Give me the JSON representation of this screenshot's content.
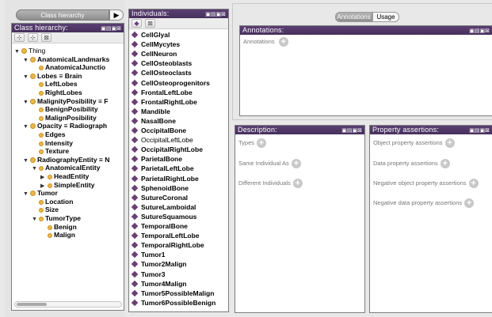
{
  "class_panel": {
    "tab_label": "Class hierarchy",
    "tab_arrow": "▶",
    "view_title": "Class hierarchy:",
    "view_controls": "▣▤▣⊠",
    "toolbar_icons": [
      "add-subclass-icon",
      "add-sibling-icon",
      "delete-class-icon"
    ],
    "tree": [
      {
        "label": "Thing",
        "arrow": "▼",
        "depth": 0
      },
      {
        "label": "AnatomicalLandmarks",
        "arrow": "▼",
        "depth": 1
      },
      {
        "label": "AnatomicalJunctio",
        "arrow": "",
        "depth": 2
      },
      {
        "label": "Lobes ≡ Brain",
        "arrow": "▼",
        "depth": 1
      },
      {
        "label": "LeftLobes",
        "arrow": "",
        "depth": 2
      },
      {
        "label": "RightLobes",
        "arrow": "",
        "depth": 2
      },
      {
        "label": "MalignityPosibility ≡ F",
        "arrow": "▼",
        "depth": 1
      },
      {
        "label": "BenignPosibility",
        "arrow": "",
        "depth": 2
      },
      {
        "label": "MalignPosibility",
        "arrow": "",
        "depth": 2
      },
      {
        "label": "Opacity ≡ Radiograph",
        "arrow": "▼",
        "depth": 1
      },
      {
        "label": "Edges",
        "arrow": "",
        "depth": 2
      },
      {
        "label": "Intensity",
        "arrow": "",
        "depth": 2
      },
      {
        "label": "Texture",
        "arrow": "",
        "depth": 2
      },
      {
        "label": "RadiographyEntity ≡ N",
        "arrow": "▼",
        "depth": 1
      },
      {
        "label": "AnatomicalEntity",
        "arrow": "▼",
        "depth": 2
      },
      {
        "label": "HeadEntity",
        "arrow": "▶",
        "depth": 3
      },
      {
        "label": "SimpleEntity",
        "arrow": "▶",
        "depth": 3
      },
      {
        "label": "Tumor",
        "arrow": "▼",
        "depth": 1
      },
      {
        "label": "Location",
        "arrow": "",
        "depth": 2
      },
      {
        "label": "Size",
        "arrow": "",
        "depth": 2
      },
      {
        "label": "TumorType",
        "arrow": "▼",
        "depth": 2
      },
      {
        "label": "Benign",
        "arrow": "",
        "depth": 3
      },
      {
        "label": "Malign",
        "arrow": "",
        "depth": 3
      }
    ]
  },
  "individuals_panel": {
    "view_title": "Individuals:",
    "view_controls": "▣▤▣⊠",
    "toolbar_icons": [
      "add-individual-icon",
      "delete-individual-icon"
    ],
    "items": [
      {
        "label": "CellGlyal",
        "bold": true
      },
      {
        "label": "CellMycytes",
        "bold": true
      },
      {
        "label": "CellNeuron",
        "bold": true
      },
      {
        "label": "CellOsteoblasts",
        "bold": true
      },
      {
        "label": "CellOsteoclasts",
        "bold": true
      },
      {
        "label": "CellOsteoprogenitors",
        "bold": true
      },
      {
        "label": "FrontalLeftLobe",
        "bold": true
      },
      {
        "label": "FrontalRightLobe",
        "bold": true
      },
      {
        "label": "Mandible",
        "bold": true
      },
      {
        "label": "NasalBone",
        "bold": true
      },
      {
        "label": "OccipitalBone",
        "bold": true
      },
      {
        "label": "OccipitalLeftLobe",
        "bold": false
      },
      {
        "label": "OccipitalRightLobe",
        "bold": true
      },
      {
        "label": "ParietalBone",
        "bold": true
      },
      {
        "label": "ParietalLeftLobe",
        "bold": true
      },
      {
        "label": "ParietalRightLobe",
        "bold": true
      },
      {
        "label": "SphenoidBone",
        "bold": true
      },
      {
        "label": "SutureCoronal",
        "bold": true
      },
      {
        "label": "SutureLamboidal",
        "bold": true
      },
      {
        "label": "SutureSquamous",
        "bold": true
      },
      {
        "label": "TemporalBone",
        "bold": true
      },
      {
        "label": "TemporalLeftLobe",
        "bold": true
      },
      {
        "label": "TemporalRightLobe",
        "bold": true
      },
      {
        "label": "Tumor1",
        "bold": true
      },
      {
        "label": "Tumor2Malign",
        "bold": true
      },
      {
        "label": "Tumor3",
        "bold": true
      },
      {
        "label": "Tumor4Malign",
        "bold": true
      },
      {
        "label": "Tumor5PossibleMalign",
        "bold": true
      },
      {
        "label": "Tumor6PossibleBenign",
        "bold": true
      }
    ]
  },
  "annotations_panel": {
    "tabs": [
      {
        "label": "Annotations",
        "active": true
      },
      {
        "label": "Usage",
        "active": false
      }
    ],
    "view_title": "Annotations:",
    "view_controls": "▣▤▣⊠",
    "section_label": "Annotations"
  },
  "description_panel": {
    "view_title": "Description:",
    "view_controls": "▣▤▣⊠",
    "sections": [
      "Types",
      "Same Individual As",
      "Different Individuals"
    ]
  },
  "property_panel": {
    "view_title": "Property assertions:",
    "view_controls": "▣▤▣⊠",
    "sections": [
      "Object property assertions",
      "Data property assertions",
      "Negative object property assertions",
      "Negative data property assertions"
    ]
  },
  "colors": {
    "view_header": "#4c3462",
    "class_dot": "#e9b84a",
    "individual_diamond": "#6d3d78"
  }
}
